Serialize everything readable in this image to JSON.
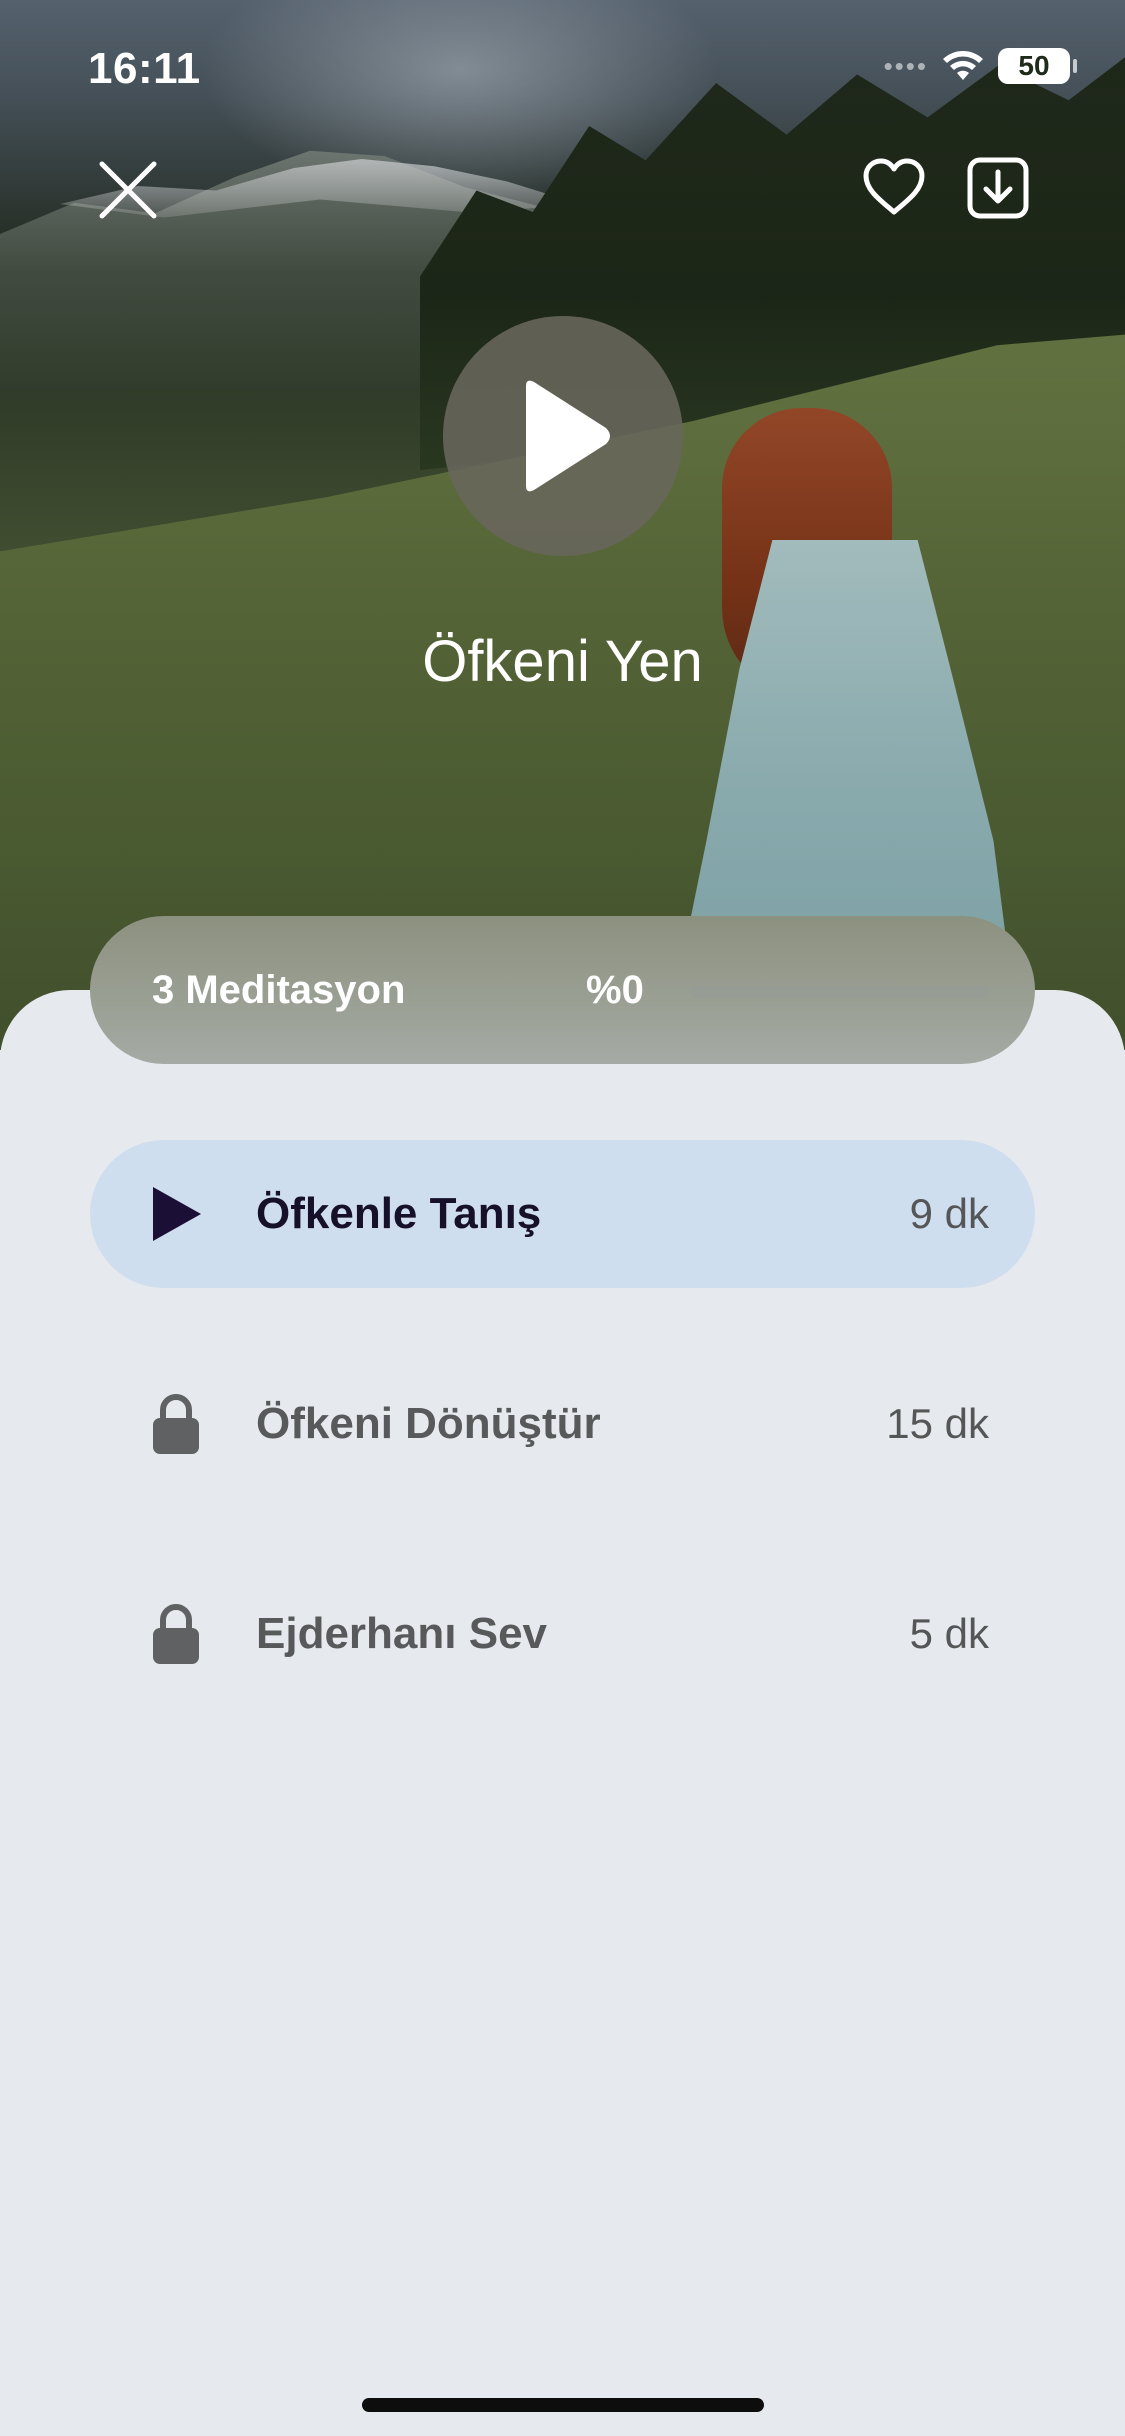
{
  "status_bar": {
    "time": "16:11",
    "battery": "50",
    "signal_icon": "cellular-signal-icon",
    "wifi_icon": "wifi-icon"
  },
  "header": {
    "close_icon": "close-icon",
    "favorite_icon": "heart-icon",
    "download_icon": "download-icon",
    "play_icon": "play-icon",
    "title": "Öfkeni Yen"
  },
  "progress": {
    "count_label": "3 Meditasyon",
    "percent_label": "%0",
    "fraction": 0
  },
  "meditations": [
    {
      "title": "Öfkenle Tanış",
      "duration": "9 dk",
      "state": "playable",
      "icon": "play-icon"
    },
    {
      "title": "Öfkeni Dönüştür",
      "duration": "15 dk",
      "state": "locked",
      "icon": "lock-icon"
    },
    {
      "title": "Ejderhanı Sev",
      "duration": "5 dk",
      "state": "locked",
      "icon": "lock-icon"
    }
  ],
  "colors": {
    "active_row": "#cfdeee",
    "sheet": "#e6e9ed",
    "play_triangle": "#1b0f36",
    "lock": "#606163"
  }
}
